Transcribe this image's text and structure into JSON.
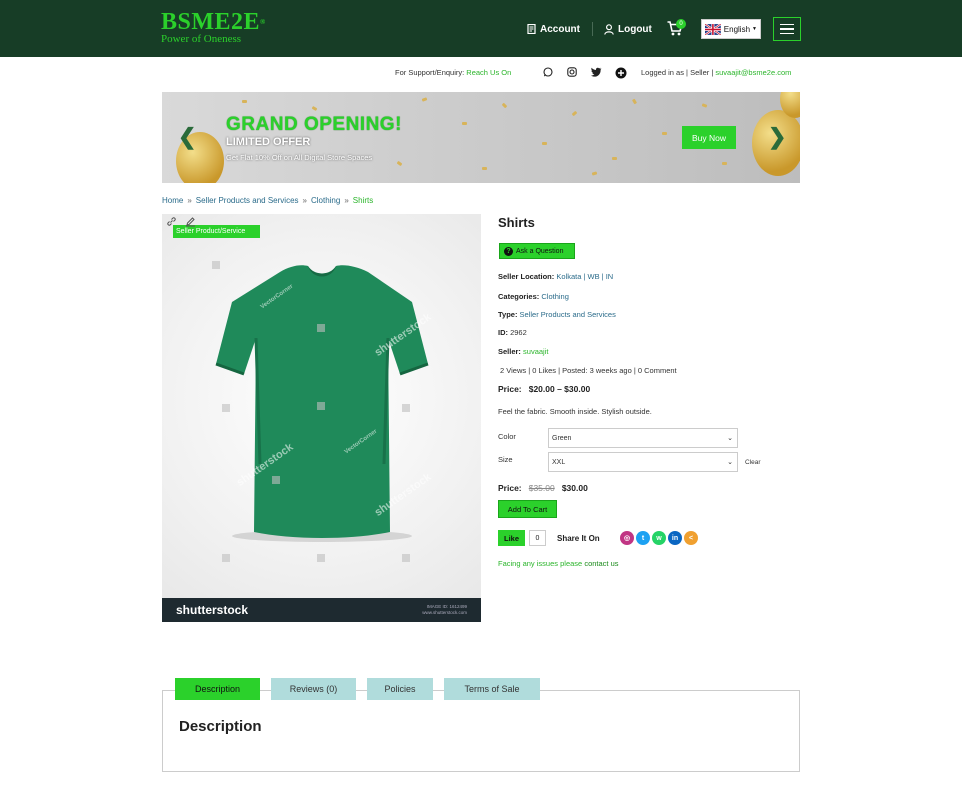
{
  "header": {
    "brand": "BSME2E",
    "brand_mark": "®",
    "tagline": "Power of Oneness",
    "account": "Account",
    "logout": "Logout",
    "cart_count": "0",
    "language": "English"
  },
  "support": {
    "label": "For Support/Enquiry:",
    "link": "Reach Us On",
    "logged_in": "Logged in as",
    "role": "Seller",
    "email": "suvaajit@bsme2e.com"
  },
  "banner": {
    "title": "GRAND OPENING!",
    "subtitle": "LIMITED OFFER",
    "text": "Get Flat 10% Off on All Digital Store Spaces",
    "button": "Buy Now",
    "prev": "❮",
    "next": "❯"
  },
  "breadcrumb": {
    "items": [
      "Home",
      "Seller Products and Services",
      "Clothing",
      "Shirts"
    ],
    "sep": "»"
  },
  "product": {
    "badge": "Seller Product/Service",
    "title": "Shirts",
    "ask": "Ask a Question",
    "location_label": "Seller Location:",
    "location": "Kolkata | WB | IN",
    "categories_label": "Categories:",
    "categories": "Clothing",
    "type_label": "Type:",
    "type": "Seller Products and Services",
    "id_label": "ID:",
    "id": "2962",
    "seller_label": "Seller:",
    "seller": "suvaajit",
    "stats": "2 Views | 0 Likes | Posted: 3 weeks ago | 0 Comment",
    "price_label": "Price:",
    "price_range": "$20.00 – $30.00",
    "description": "Feel the fabric. Smooth inside. Stylish outside.",
    "color_label": "Color",
    "color_value": "Green",
    "size_label": "Size",
    "size_value": "XXL",
    "clear": "Clear",
    "price_label2": "Price:",
    "old_price": "$35.00",
    "new_price": "$30.00",
    "add_to_cart": "Add To Cart",
    "like": "Like",
    "like_count": "0",
    "share": "Share It On",
    "report_prefix": "Facing any issues please",
    "report_link": "contact us"
  },
  "image": {
    "watermark": "shutterstock",
    "watermark_small": "VectorCorner",
    "footer_brand": "shutterstock",
    "footer_info_1": "IMAGE ID: 1612499",
    "footer_info_2": "www.shutterstock.com"
  },
  "social_icons": [
    {
      "name": "instagram-icon",
      "color": "#c13584",
      "glyph": "◎"
    },
    {
      "name": "twitter-icon",
      "color": "#1da1f2",
      "glyph": "t"
    },
    {
      "name": "whatsapp-icon",
      "color": "#25d366",
      "glyph": "w"
    },
    {
      "name": "linkedin-icon",
      "color": "#0a66c2",
      "glyph": "in"
    },
    {
      "name": "share-icon",
      "color": "#f0a030",
      "glyph": "<"
    }
  ],
  "tabs": [
    {
      "label": "Description",
      "active": true
    },
    {
      "label": "Reviews (0)",
      "active": false
    },
    {
      "label": "Policies",
      "active": false
    },
    {
      "label": "Terms of Sale",
      "active": false
    }
  ],
  "tab_content": {
    "heading": "Description"
  },
  "colors": {
    "header_bg": "#173d26",
    "accent": "#2bd12b",
    "tab_inactive": "#b0dcdc",
    "shirt": "#1f8a5a"
  }
}
